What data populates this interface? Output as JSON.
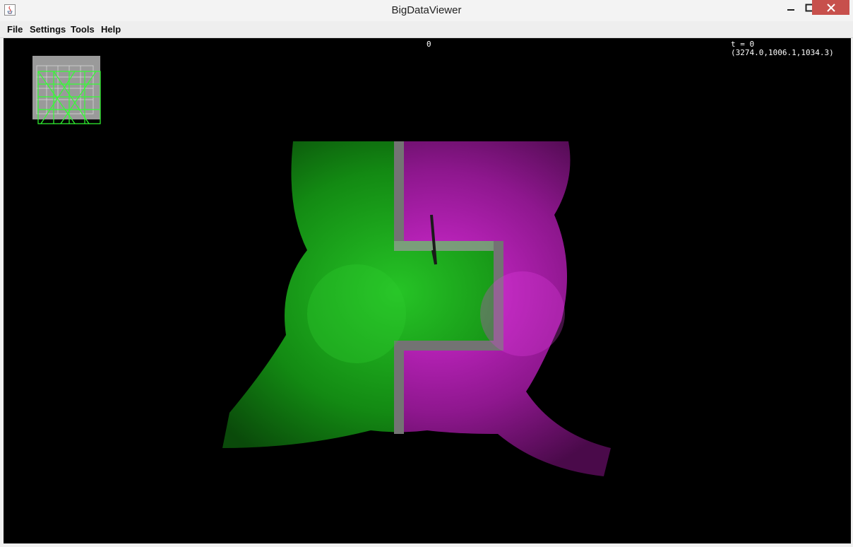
{
  "window": {
    "title": "BigDataViewer",
    "icon": "java-icon",
    "buttons": [
      "minimize-icon",
      "maximize-icon",
      "close-icon"
    ]
  },
  "menu": {
    "items": [
      "File",
      "Settings",
      "Tools",
      "Help"
    ]
  },
  "viewer": {
    "source_label": "0",
    "timepoint": "t = 0",
    "coordinates": "(3274.0,1006.1,1034.3)",
    "colors": {
      "background": "#000000",
      "channel_green": "#1fb21f",
      "channel_magenta": "#c21fc2",
      "boundary_gray": "#9a9a9a",
      "minimap_box": "#9a9a9a",
      "minimap_lines": "#33ff33"
    }
  }
}
